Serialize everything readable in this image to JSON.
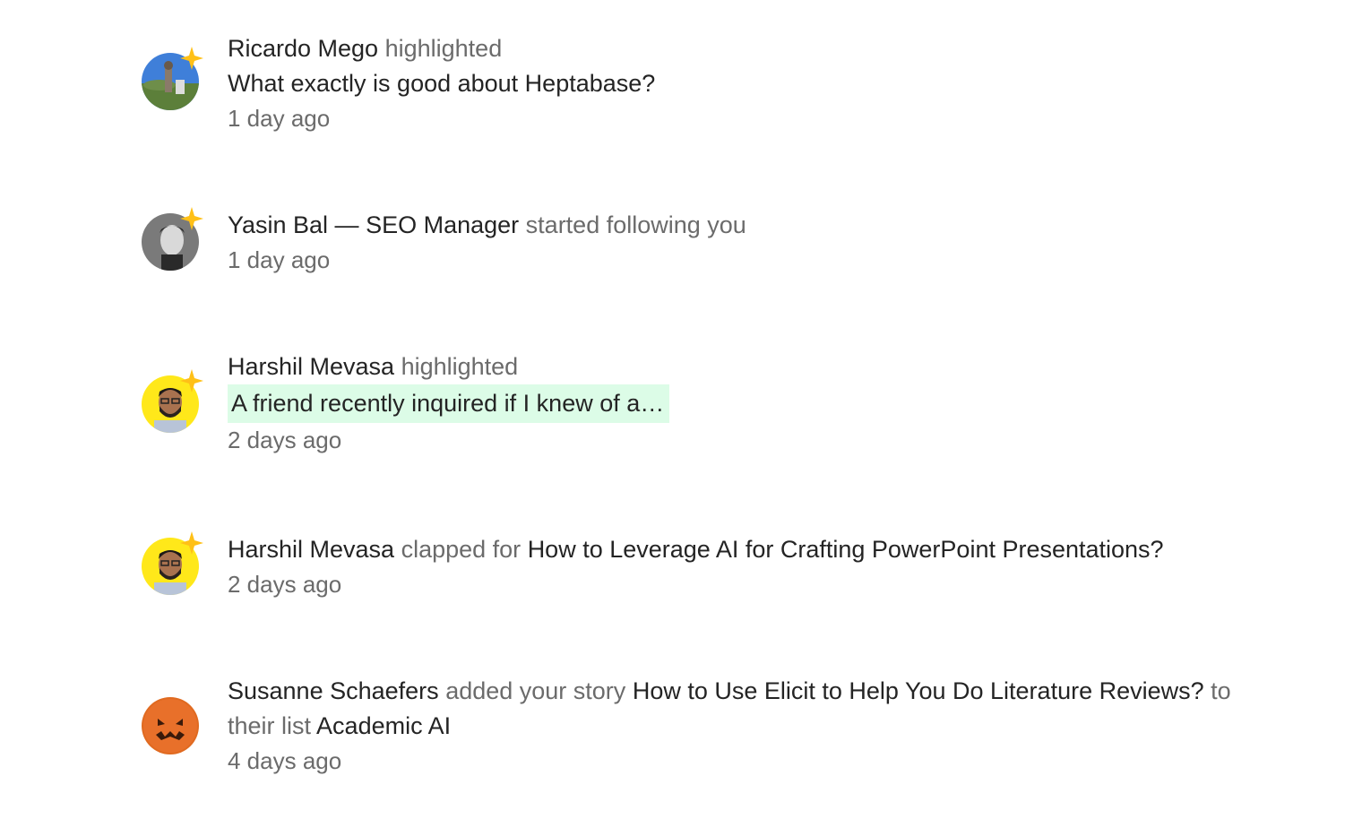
{
  "notifications": [
    {
      "actor": "Ricardo Mego",
      "action": "highlighted",
      "excerpt": "What exactly is good about Heptabase?",
      "time": "1 day ago"
    },
    {
      "actor": "Yasin Bal — SEO Manager",
      "action": "started following you",
      "time": "1 day ago"
    },
    {
      "actor": "Harshil Mevasa",
      "action": "highlighted",
      "excerpt": "A friend recently inquired if I knew of a…",
      "time": "2 days ago"
    },
    {
      "actor": "Harshil Mevasa",
      "action": "clapped for",
      "story": "How to Leverage AI for Crafting PowerPoint Presentations?",
      "time": "2 days ago"
    },
    {
      "actor": "Susanne Schaefers",
      "action": "added your story",
      "story": "How to Use Elicit to Help You Do Literature Reviews?",
      "connector": "to their list",
      "list": "Academic AI",
      "time": "4 days ago"
    }
  ],
  "colors": {
    "text": "#242424",
    "muted": "#6b6b6b",
    "highlight": "#dcfce7",
    "star": "#ffc017"
  },
  "icons": {
    "member_badge": "star-icon"
  }
}
